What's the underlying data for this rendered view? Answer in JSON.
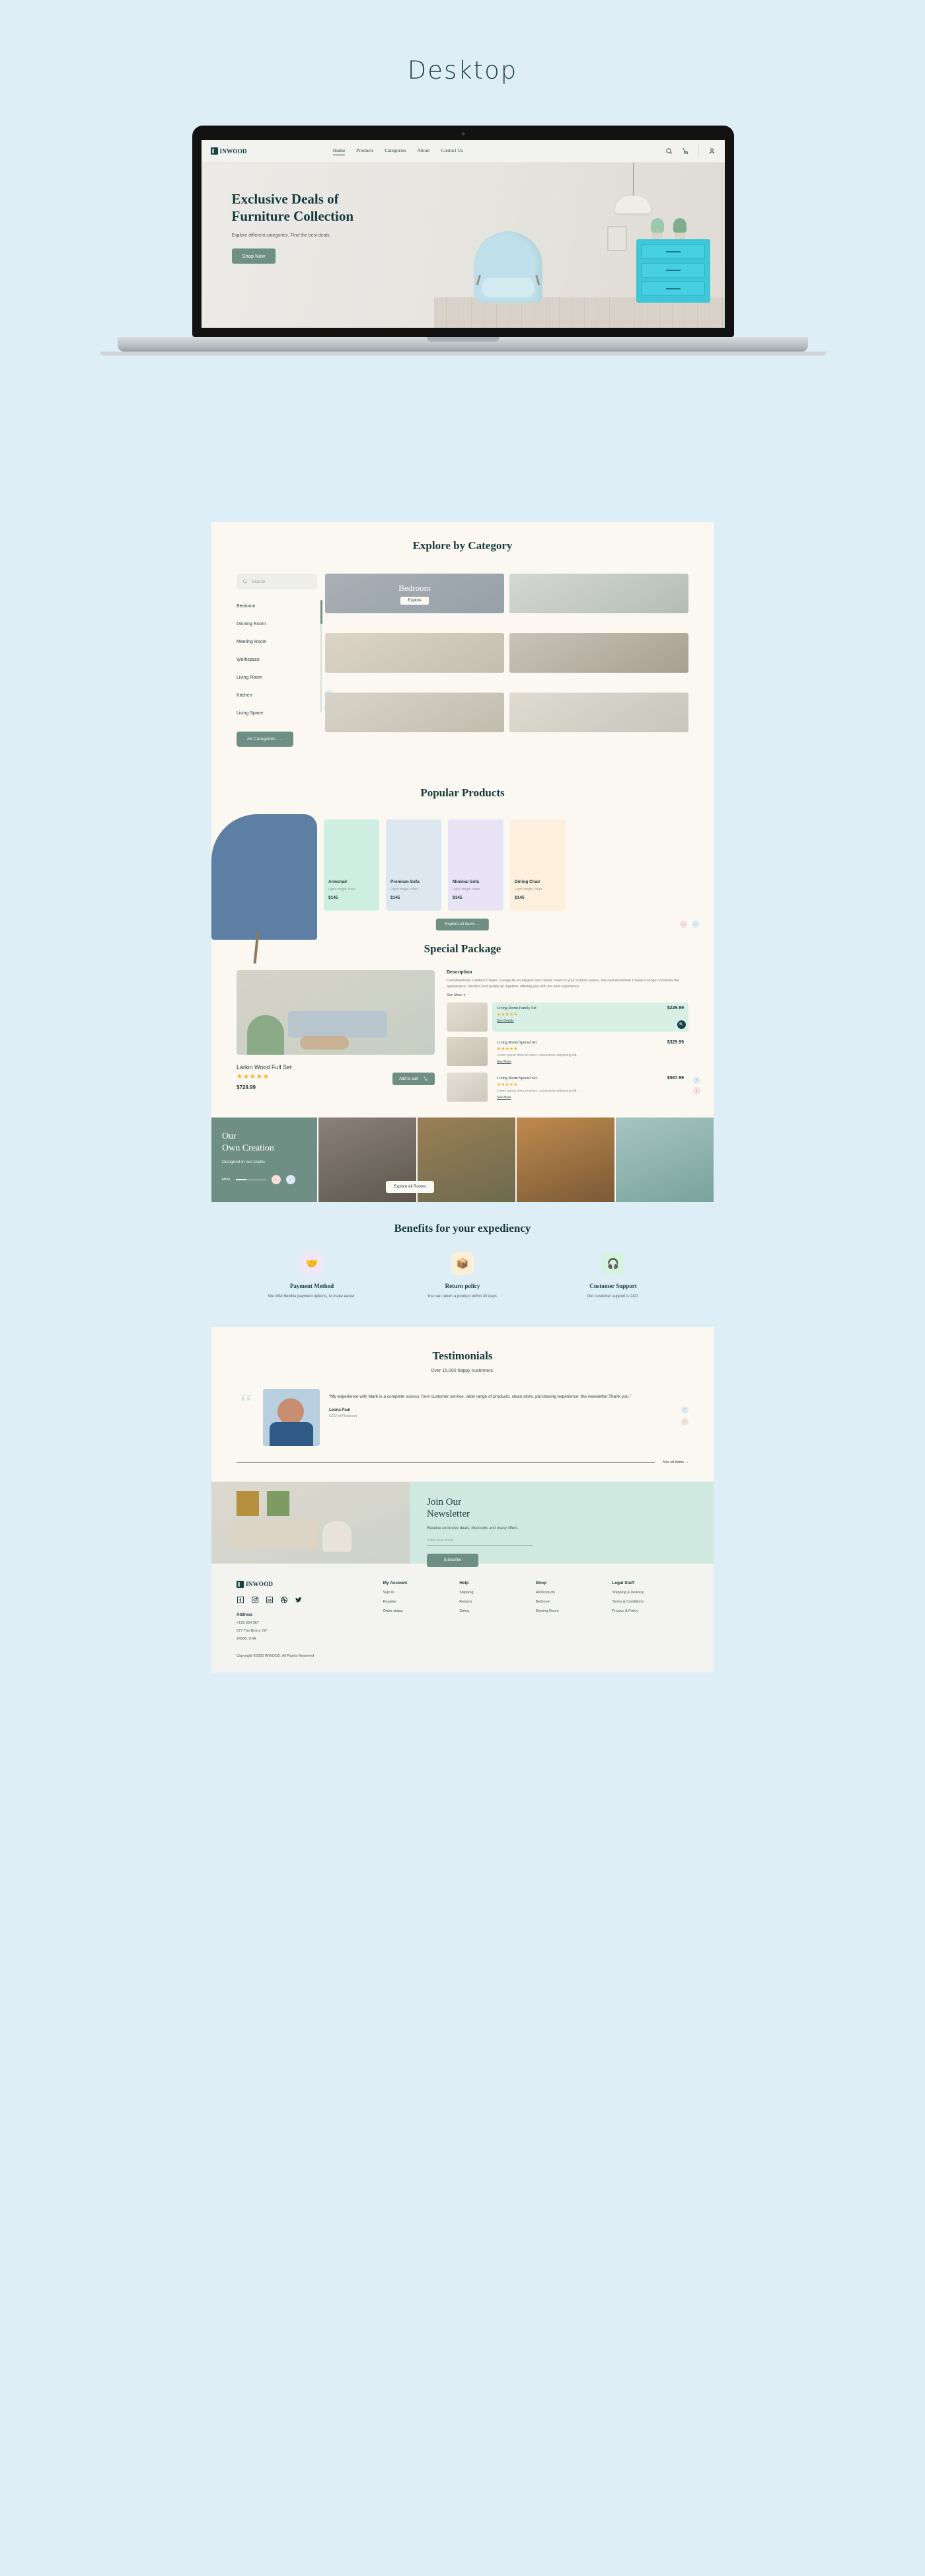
{
  "page": {
    "title": "Desktop",
    "background": "#deeef6"
  },
  "brand": {
    "name": "INWOOD",
    "accent": "#6f8f85",
    "dark": "#17393d"
  },
  "nav": {
    "links": [
      {
        "label": "Home",
        "active": true
      },
      {
        "label": "Products",
        "active": false
      },
      {
        "label": "Categories",
        "active": false
      },
      {
        "label": "About",
        "active": false
      },
      {
        "label": "Contact Us",
        "active": false
      }
    ],
    "icons": [
      "search-icon",
      "cart-icon",
      "account-icon"
    ]
  },
  "hero": {
    "title_line1": "Exclusive Deals of",
    "title_line2": "Furniture Collection",
    "subtitle": "Explore different categories. Find the best deals.",
    "cta": "Shop Now"
  },
  "category_section": {
    "heading": "Explore by Category",
    "search_placeholder": "Search",
    "items": [
      "Bedroom",
      "Dinning Room",
      "Meeting Room",
      "Workspace",
      "Living Room",
      "Kitchen",
      "Living Space"
    ],
    "all_button": "All Categories",
    "featured_card": {
      "name": "Bedroom",
      "cta": "Explore"
    }
  },
  "popular": {
    "heading": "Popular Products",
    "products": [
      {
        "name": "Armchair",
        "desc": "Light single chair",
        "price": "$145",
        "bg": "#cdeee0"
      },
      {
        "name": "Premium Sofa",
        "desc": "Light single chair",
        "price": "$145",
        "bg": "#dde7ef"
      },
      {
        "name": "Minimal Sofa",
        "desc": "Light single chair",
        "price": "$145",
        "bg": "#e8e4f6"
      },
      {
        "name": "Dining Chair",
        "desc": "Light single chair",
        "price": "$145",
        "bg": "#fcf0dd"
      }
    ],
    "explore_button": "Explore All Items"
  },
  "special": {
    "heading": "Special Package",
    "product_name": "Larkin Wood Full Set",
    "rating": "★★★★★",
    "price": "$729.99",
    "add_to_cart": "Add to cart",
    "description_heading": "Description",
    "description_text": "Cast Aluminum Outdoor Chaise Lounge As an elegant and classic touch to your outdoor space, this cast Aluminum Chaise Lounge combines the appearance, function and quality all together, offering you with the best experience.",
    "see_more": "See More",
    "list": [
      {
        "name": "Living Room Family Set",
        "price": "$229.99",
        "rating": "★★★★★",
        "desc": "",
        "link": "See Details",
        "highlight": true
      },
      {
        "name": "Living Room Special Set",
        "price": "$329.99",
        "rating": "★★★★★",
        "desc": "Lorem ipsum dolor sit amet, consectetur adipiscing elit.",
        "link": "See More",
        "highlight": false
      },
      {
        "name": "Living Room Special Set",
        "price": "$587.99",
        "rating": "★★★★★",
        "desc": "Lorem ipsum dolor sit amet, consectetur adipiscing elit.",
        "link": "See More",
        "highlight": false
      }
    ]
  },
  "own_creation": {
    "title_line1": "Our",
    "title_line2": "Own Creation",
    "subtitle": "Designed in our studio",
    "more_label": "More",
    "explore_button": "Explore All Rooms"
  },
  "benefits": {
    "heading": "Benefits for your expediency",
    "items": [
      {
        "title": "Payment Method",
        "text": "We offer flexible payment options, to make easier.",
        "icon": "handshake-icon",
        "bg": "#f2e6f7",
        "glyph": "✋"
      },
      {
        "title": "Return policy",
        "text": "You can return a product within 30 days.",
        "icon": "package-return-icon",
        "bg": "#fdeed6",
        "glyph": "📦"
      },
      {
        "title": "Customer Support",
        "text": "Our customer support is 24/7.",
        "icon": "headset-icon",
        "bg": "#d6f3e0",
        "glyph": "🎧"
      }
    ]
  },
  "testimonials": {
    "heading": "Testimonials",
    "subheading": "Over 15,000 happy customers.",
    "quote": "“My experience with Mark is a complete sucess, from customer service, wide range of products, clean store, purchasing experience, the newsletter.Thank you.”",
    "author": "Leona Paul",
    "role": "CEO of Floatcom",
    "see_all": "See all items"
  },
  "newsletter": {
    "title_line1": "Join Our",
    "title_line2": "Newsletter",
    "subtitle": "Receive exclusive deals, discounts and many offers.",
    "input_placeholder": "Enter your email",
    "button": "Subscribe"
  },
  "footer": {
    "brand": "INWOOD",
    "social": [
      "facebook-icon",
      "instagram-icon",
      "linkedin-icon",
      "dribbble-icon",
      "twitter-icon"
    ],
    "address_heading": "Address",
    "address_lines": [
      "+123 654 987",
      "877  The Bronx, NY",
      "14568, USA"
    ],
    "columns": [
      {
        "heading": "My Account",
        "links": [
          "Sign in",
          "Register",
          "Order status"
        ]
      },
      {
        "heading": "Help",
        "links": [
          "Shipping",
          "Returns",
          "Sizing"
        ]
      },
      {
        "heading": "Shop",
        "links": [
          "All Products",
          "Bedroom",
          "Dinning Room"
        ]
      },
      {
        "heading": "Legal Stuff",
        "links": [
          "Shipping & Delivery",
          "Terms & Conditions",
          "Privacy & Policy"
        ]
      }
    ],
    "copyright": "Copyright ©2020 INWOOD. All Rights Reserved"
  }
}
